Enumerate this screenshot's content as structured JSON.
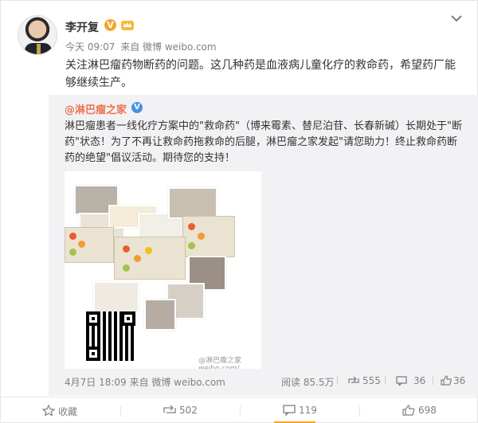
{
  "post": {
    "author": "李开复",
    "verified_badge": "V",
    "timestamp": "今天 09:07",
    "source": "来自 微博 weibo.com",
    "text": "关注淋巴瘤药物断药的问题。这几种药是血液病儿童化疗的救命药，希望药厂能够继续生产。"
  },
  "repost": {
    "author": "@淋巴瘤之家",
    "verified_badge": "V",
    "text_part1": "淋巴瘤患者一线化疗方案中的\"救命药\"（博来霉素、替尼泊苷、长春新碱）长期处于\"断药\"状态！为了不再让救命药拖救命的后腿，淋巴瘤之家发起\"请您助力！终止救命药断药的绝望\"倡议活动。期待您的支持！",
    "date": "4月7日 18:09",
    "source": "来自 微博 weibo.com",
    "reads": "阅读 85.5万",
    "reposts": "555",
    "comments": "36",
    "likes": "36",
    "collage_watermark": "@淋巴瘤之家 weibo.com/..."
  },
  "toolbar": {
    "favorite": "收藏",
    "repost": "502",
    "comment": "119",
    "like": "698"
  },
  "icons": {
    "menu": "chevron-down-icon",
    "verified": "v-badge-icon",
    "membership": "crown-icon",
    "favorite": "star-icon",
    "repost": "share-icon",
    "comment": "comment-icon",
    "like": "thumbs-up-icon"
  },
  "colors": {
    "accent": "#f5a623",
    "link": "#eb7350",
    "verified_orange": "#f3a52b",
    "verified_blue": "#4a90e2",
    "repost_bg": "#f2f2f5"
  }
}
